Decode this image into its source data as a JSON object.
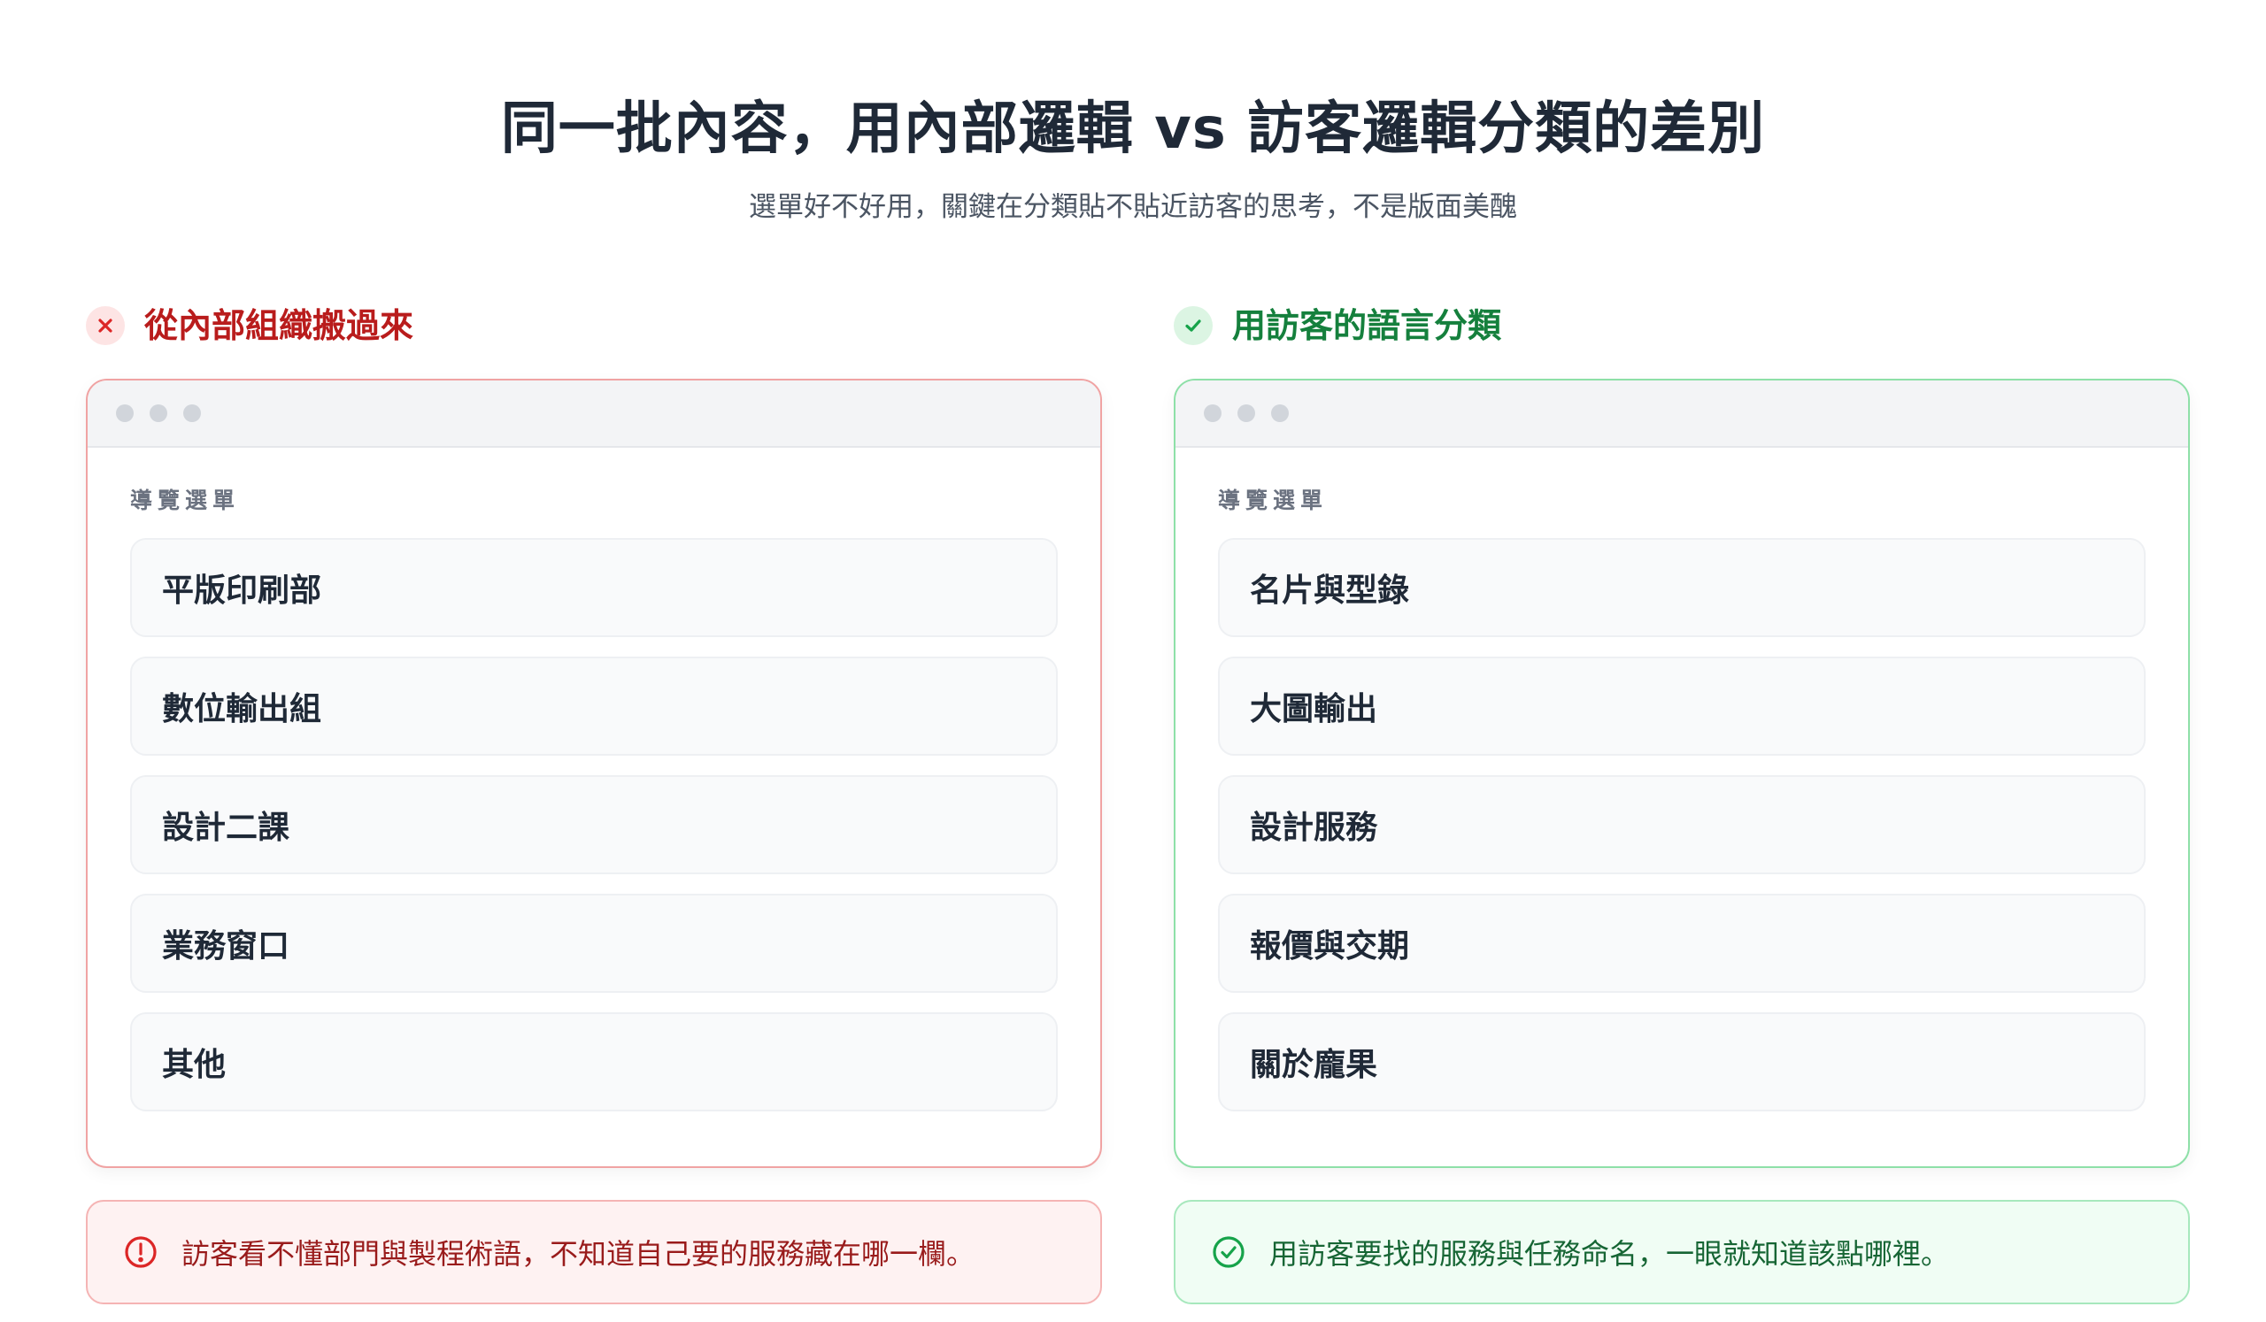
{
  "header": {
    "title": "同一批內容，用內部邏輯 vs 訪客邏輯分類的差別",
    "subtitle": "選單好不好用，關鍵在分類貼不貼近訪客的思考，不是版面美醜"
  },
  "colors": {
    "bad_accent": "#b91c1c",
    "good_accent": "#15803d"
  },
  "left": {
    "heading": "從內部組織搬過來",
    "icon": "x-icon",
    "nav_label": "導覽選單",
    "items": [
      "平版印刷部",
      "數位輸出組",
      "設計二課",
      "業務窗口",
      "其他"
    ],
    "note_icon": "alert-circle-icon",
    "note": "訪客看不懂部門與製程術語，不知道自己要的服務藏在哪一欄。"
  },
  "right": {
    "heading": "用訪客的語言分類",
    "icon": "check-icon",
    "nav_label": "導覽選單",
    "items": [
      "名片與型錄",
      "大圖輸出",
      "設計服務",
      "報價與交期",
      "關於龐果"
    ],
    "note_icon": "check-circle-icon",
    "note": "用訪客要找的服務與任務命名，一眼就知道該點哪裡。"
  }
}
